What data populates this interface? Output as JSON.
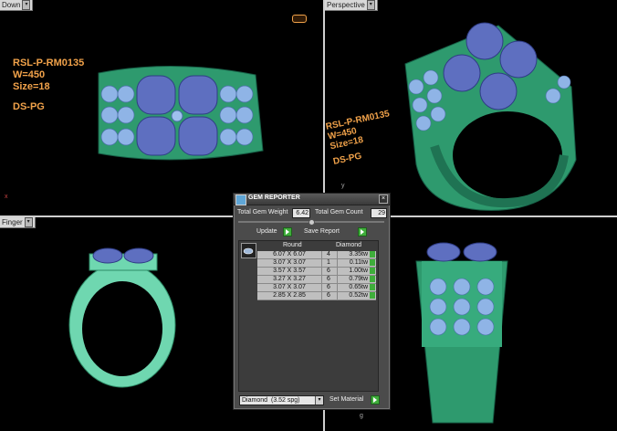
{
  "viewports": {
    "top_left": {
      "tab": "Down"
    },
    "top_right": {
      "tab": "Perspective"
    },
    "bottom_left": {
      "tab": "Finger"
    }
  },
  "annotation_top_left": {
    "line1": "RSL-P-RM0135",
    "line2": "W=450",
    "line3": "Size=18",
    "line4": "DS-PG"
  },
  "annotation_perspective": {
    "line1": "RSL-P-RM0135",
    "line2": "W=450",
    "line3": "Size=18",
    "line4": "DS-PG"
  },
  "axis_labels": {
    "top_left_x": "x",
    "top_right_y": "y",
    "bottom_right_g": "g"
  },
  "gem_reporter": {
    "title": "GEM REPORTER",
    "total_gem_weight_label": "Total Gem Weight",
    "total_gem_weight": "6.42",
    "total_gem_count_label": "Total Gem Count",
    "total_gem_count": "29",
    "update_label": "Update",
    "save_report_label": "Save Report",
    "columns": [
      "Round",
      "Diamond"
    ],
    "rows": [
      {
        "size": "6.07 X 6.07",
        "count": "4",
        "weight": "3.35tw"
      },
      {
        "size": "3.07 X 3.07",
        "count": "1",
        "weight": "0.11tw"
      },
      {
        "size": "3.57 X 3.57",
        "count": "6",
        "weight": "1.00tw"
      },
      {
        "size": "3.27 X 3.27",
        "count": "6",
        "weight": "0.79tw"
      },
      {
        "size": "3.07 X 3.07",
        "count": "6",
        "weight": "0.65tw"
      },
      {
        "size": "2.85 X 2.85",
        "count": "6",
        "weight": "0.52tw"
      }
    ],
    "material_select": "Diamond",
    "material_sg": "(3.52 spg)",
    "set_material_label": "Set Material"
  },
  "colors": {
    "ring_green": "#2e9a6e",
    "gem_blue": "#5e6fc0",
    "annotation_orange": "#f1a24a",
    "go_button_green": "#3fae3b"
  }
}
